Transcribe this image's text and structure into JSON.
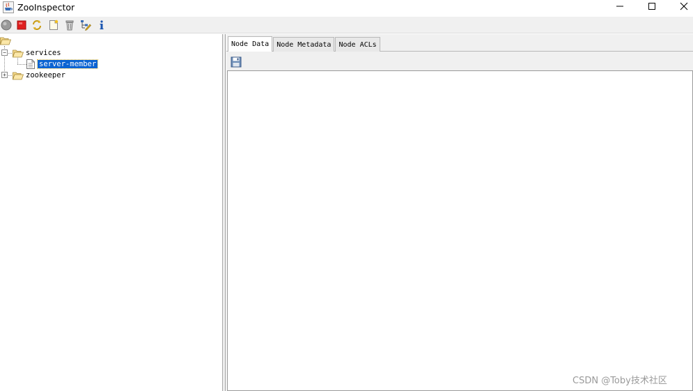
{
  "window": {
    "title": "ZooInspector",
    "app_icon": "java-cup-icon",
    "controls": [
      "minimize-icon",
      "maximize-icon",
      "close-icon"
    ]
  },
  "toolbar": {
    "buttons": [
      {
        "name": "connect-button",
        "icon": "connect-circle-icon"
      },
      {
        "name": "disconnect-button",
        "icon": "stop-square-icon"
      },
      {
        "name": "refresh-button",
        "icon": "refresh-arrows-icon"
      },
      {
        "name": "add-node-button",
        "icon": "new-document-icon"
      },
      {
        "name": "delete-node-button",
        "icon": "trash-icon"
      },
      {
        "name": "node-viewers-button",
        "icon": "tree-edit-icon"
      },
      {
        "name": "about-button",
        "icon": "info-icon"
      }
    ]
  },
  "tree": {
    "root_icon": "folder-open-icon",
    "nodes": [
      {
        "label": "services",
        "expanded": true,
        "icon": "folder-open-icon"
      },
      {
        "label": "server-member",
        "selected": true,
        "icon": "document-icon"
      },
      {
        "label": "zookeeper",
        "expanded": false,
        "icon": "folder-open-icon"
      }
    ]
  },
  "tabs": [
    {
      "label": "Node Data",
      "active": true
    },
    {
      "label": "Node Metadata",
      "active": false
    },
    {
      "label": "Node ACLs",
      "active": false
    }
  ],
  "node_data": {
    "save_icon": "floppy-disk-icon",
    "content": ""
  },
  "watermark": "CSDN @Toby技术社区",
  "colors": {
    "selection": "#0a64d2",
    "panel_bg": "#f0f0f0"
  }
}
